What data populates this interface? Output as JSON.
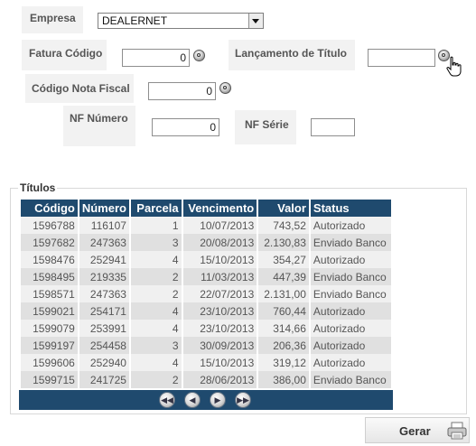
{
  "form": {
    "empresa_label": "Empresa",
    "empresa_value": "DEALERNET",
    "fatura_label": "Fatura Código",
    "fatura_value": "0",
    "lancamento_label": "Lançamento de Título",
    "lancamento_value": "",
    "nota_label": "Código Nota Fiscal",
    "nota_value": "0",
    "nf_numero_label": "NF Número",
    "nf_numero_value": "0",
    "nf_serie_label": "NF Série",
    "nf_serie_value": ""
  },
  "titulos": {
    "legend": "Títulos",
    "columns": [
      "Código",
      "Número",
      "Parcela",
      "Vencimento",
      "Valor",
      "Status"
    ],
    "rows": [
      [
        "1596788",
        "116107",
        "1",
        "10/07/2013",
        "743,52",
        "Autorizado"
      ],
      [
        "1597682",
        "247363",
        "3",
        "20/08/2013",
        "2.130,83",
        "Enviado Banco"
      ],
      [
        "1598476",
        "252941",
        "4",
        "15/10/2013",
        "354,27",
        "Autorizado"
      ],
      [
        "1598495",
        "219335",
        "2",
        "11/03/2013",
        "447,39",
        "Enviado Banco"
      ],
      [
        "1598571",
        "247363",
        "2",
        "22/07/2013",
        "2.131,00",
        "Enviado Banco"
      ],
      [
        "1599021",
        "254171",
        "4",
        "23/10/2013",
        "760,44",
        "Autorizado"
      ],
      [
        "1599079",
        "253991",
        "4",
        "23/10/2013",
        "314,66",
        "Autorizado"
      ],
      [
        "1599197",
        "254458",
        "3",
        "30/09/2013",
        "206,36",
        "Autorizado"
      ],
      [
        "1599606",
        "252940",
        "4",
        "15/10/2013",
        "319,12",
        "Autorizado"
      ],
      [
        "1599715",
        "241725",
        "2",
        "28/06/2013",
        "386,00",
        "Enviado Banco"
      ]
    ],
    "pager_icons": [
      "first-page-icon",
      "prev-page-icon",
      "next-page-icon",
      "last-page-icon"
    ]
  },
  "actions": {
    "gerar_label": "Gerar"
  },
  "colors": {
    "header_bg": "#1f4a6e",
    "row_odd": "#f0f0f0",
    "row_even": "#e0e0e0"
  }
}
